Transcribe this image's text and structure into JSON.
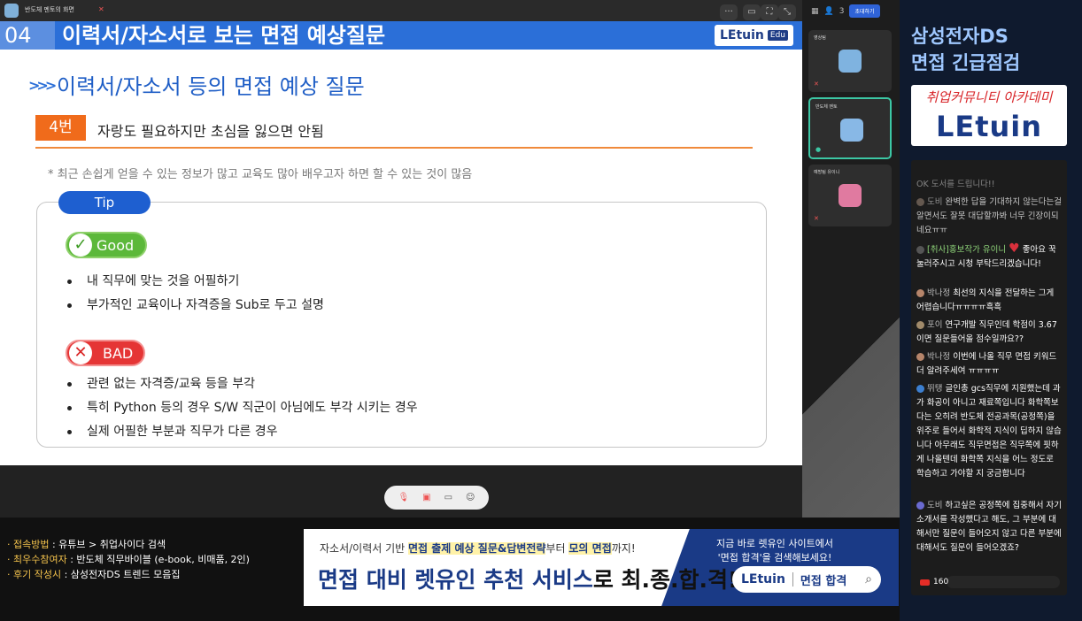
{
  "meeting": {
    "host_name": "반도체 멘토의 화면",
    "participant_count": "3",
    "invite_label": "초대하기"
  },
  "slide": {
    "number": "04",
    "header_title": "이력서/자소서로 보는 면접 예상질문",
    "logo": "LEtuin",
    "logo_badge": "Edu",
    "section_title": "이력서/자소서 등의 면접 예상 질문",
    "item_no": "4번",
    "item_text": "자랑도 필요하지만 초심을 잃으면 안됨",
    "note": "* 최근 손쉽게 얻을 수 있는 정보가 많고 교육도 많아 배우고자 하면 할 수 있는 것이 많음",
    "tip_label": "Tip",
    "good_label": "Good",
    "good_items": [
      "내 직무에 맞는 것을 어필하기",
      "부가적인 교육이나 자격증을 Sub로 두고 설명"
    ],
    "bad_label": "BAD",
    "bad_items": [
      "관련 없는 자격증/교육 등을 부각",
      "특히 Python 등의 경우 S/W 직군이 아님에도 부각 시키는 경우",
      "실제 어필한 부분과 직무가 다른 경우"
    ]
  },
  "participants": [
    {
      "name": "영상팀",
      "color": "#7fb3e0"
    },
    {
      "name": "반도체 멘토",
      "color": "#88b8e6"
    },
    {
      "name": "예방팀 유이니",
      "color": "#e07aa0"
    }
  ],
  "panel": {
    "title_line1": "삼성전자DS",
    "title_line2": "면접 긴급점검",
    "logo_top": "취업커뮤니티 아카데미",
    "logo_main": "LEtuin"
  },
  "chat": {
    "messages": [
      {
        "user": "",
        "text": "OK 도서를 드립니다!!"
      },
      {
        "user": "도비",
        "text": "완벽한 답을 기대하지 않는다는걸 알면서도 잘못 대답할까봐 너무 긴장이되네요ㅠㅠ"
      },
      {
        "user": "[취사]홍보작가 유이니",
        "text": "좋아요 꾹 눌러주시고 시청 부탁드리겠습니다!"
      },
      {
        "user": "박나정",
        "text": "최선의 지식을 전달하는 그게 어렵습니다ㅠㅠㅠㅠ흑흑"
      },
      {
        "user": "포이",
        "text": "연구개발 직무인데 학점이 3.67이면 질문들어올 점수일까요??"
      },
      {
        "user": "박나정",
        "text": "이번에 나올 직무 면접 키워드 더 알려주세여 ㅠㅠㅠㅠ"
      },
      {
        "user": "뛰탱",
        "text": "글인총 gcs직무에 지원했는데 과가 화공이 아니고 재료쪽입니다 화학쪽보다는 오히려 반도체 전공과목(공정쪽)을 위주로 들어서 화학적 지식이 딥하지 않습니다 아무래도 직무면접은 직무쪽에 핏하게 나올텐데 화학쪽 지식을 어느 정도로 학습하고 가야할 지 궁금합니다"
      },
      {
        "user": "도비",
        "text": "하고싶은 공정쪽에 집중해서 자기소개서를 작성했다고 해도, 그 부분에 대해서만 질문이 들어오지 않고 다른 부분에 대해서도 질문이 들어오겠죠?"
      }
    ],
    "likes": "160"
  },
  "info": {
    "rows": [
      {
        "key": "· 접속방법",
        "val": " : 유튜브 > 취업사이다 검색"
      },
      {
        "key": "· 최우수참여자",
        "val": " : 반도체 직무바이블 (e-book, 비매품, 2인)"
      },
      {
        "key": "· 후기 작성시",
        "val": " : 삼성전자DS 트렌드 모음집"
      }
    ]
  },
  "banner": {
    "small_pre": "자소서/이력서 기반 ",
    "small_hl": "면접 출제 예상 질문&답변전략",
    "small_mid": "부터 ",
    "small_hl2": "모의 면접",
    "small_post": "까지!",
    "big_blue": "면접 대비 렛유인 추천 서비스",
    "big_black": "로 최.종.합.격!",
    "right_line1": "지금 바로 렛유인 사이트에서",
    "right_line2": "'면접 합격'을 검색해보세요!",
    "search_logo": "LEtuin",
    "search_query": "면접 합격"
  }
}
